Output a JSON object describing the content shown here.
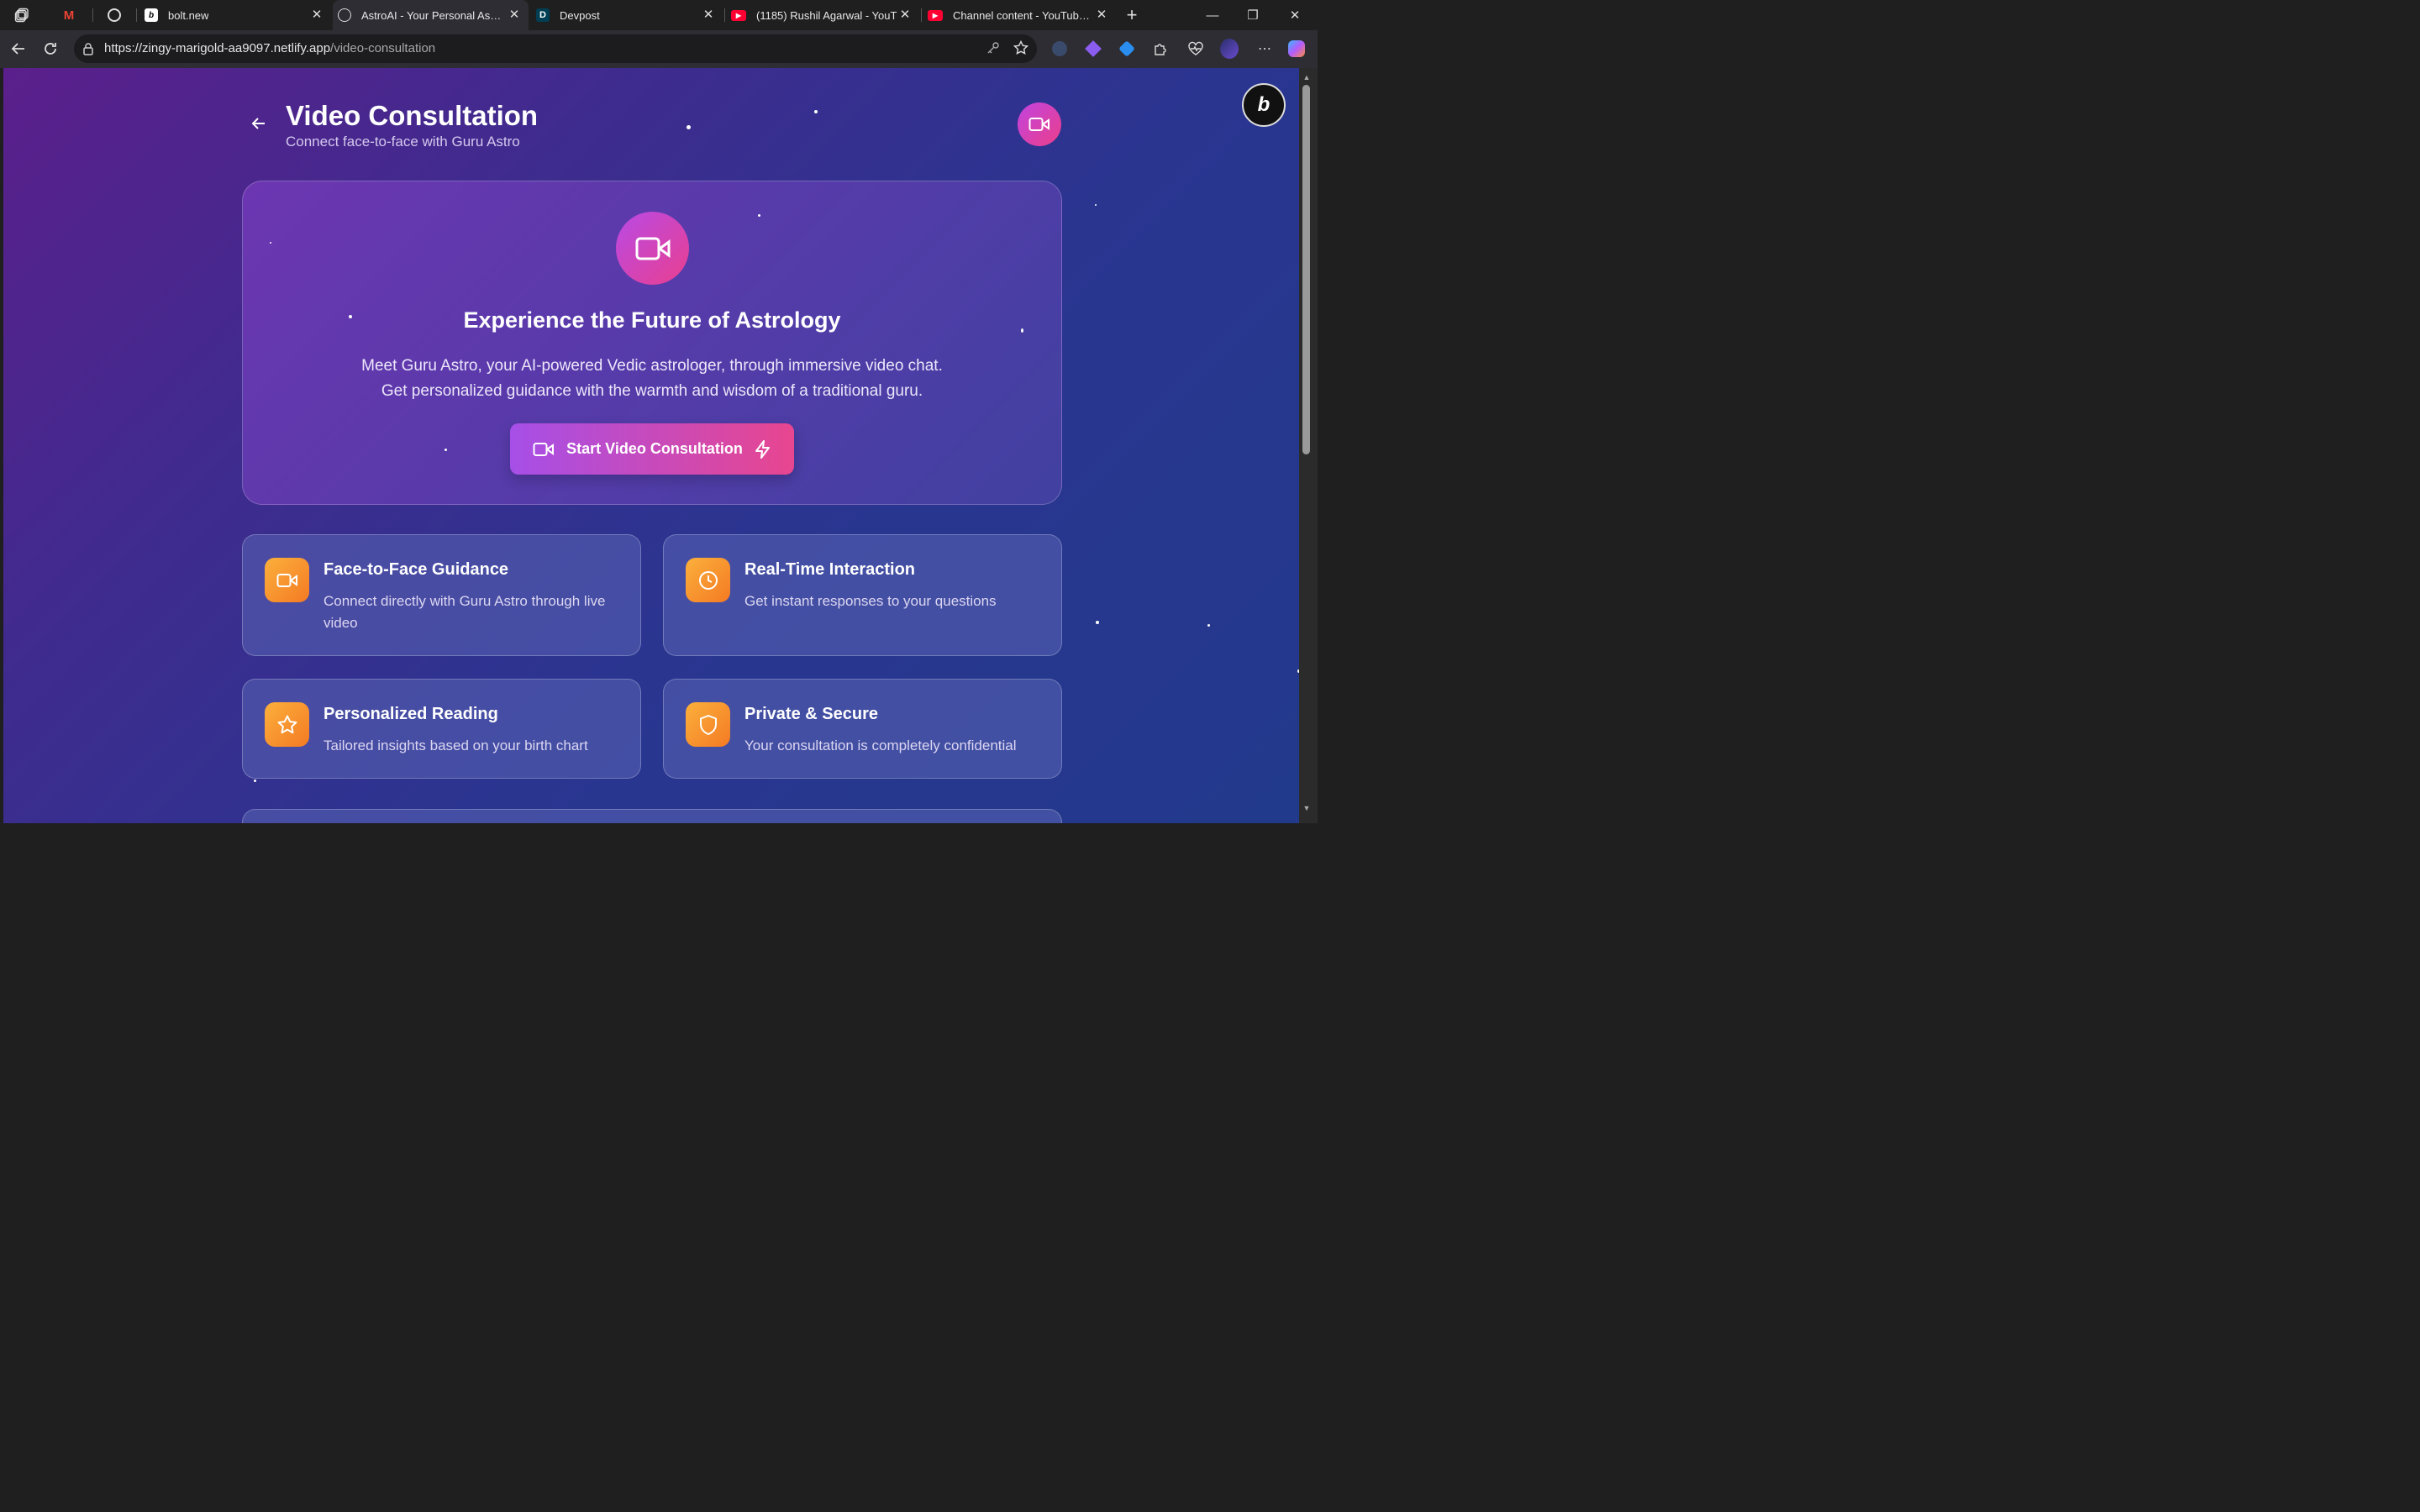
{
  "browser": {
    "tabs": [
      {
        "title": "",
        "icon": "gmail-icon"
      },
      {
        "title": "",
        "icon": "openai-icon"
      },
      {
        "title": "bolt.new",
        "icon": "bolt-icon"
      },
      {
        "title": "AstroAI - Your Personal Astro",
        "icon": "globe-icon",
        "active": true
      },
      {
        "title": "Devpost",
        "icon": "devpost-icon"
      },
      {
        "title": "(1185) Rushil Agarwal - YouT",
        "icon": "youtube-icon"
      },
      {
        "title": "Channel content - YouTube S",
        "icon": "youtube-icon"
      }
    ],
    "new_tab": "+",
    "url_host": "https://zingy-marigold-aa9097.netlify.app",
    "url_path": "/video-consultation"
  },
  "header": {
    "title": "Video Consultation",
    "subtitle": "Connect face-to-face with Guru Astro",
    "badge": "b"
  },
  "hero": {
    "heading": "Experience the Future of Astrology",
    "line1": "Meet Guru Astro, your AI-powered Vedic astrologer, through immersive video chat.",
    "line2": "Get personalized guidance with the warmth and wisdom of a traditional guru.",
    "button_label": "Start Video Consultation"
  },
  "features": [
    {
      "title": "Face-to-Face Guidance",
      "desc": "Connect directly with Guru Astro through live video",
      "icon": "video-icon"
    },
    {
      "title": "Real-Time Interaction",
      "desc": "Get instant responses to your questions",
      "icon": "clock-icon"
    },
    {
      "title": "Personalized Reading",
      "desc": "Tailored insights based on your birth chart",
      "icon": "star-icon"
    },
    {
      "title": "Private & Secure",
      "desc": "Your consultation is completely confidential",
      "icon": "shield-icon"
    }
  ],
  "colors": {
    "accent_start": "#a64fe8",
    "accent_end": "#e8468f",
    "icon_orange": "#f89a30",
    "bg_purple": "#5b1f8c",
    "bg_blue": "#223a8c"
  }
}
